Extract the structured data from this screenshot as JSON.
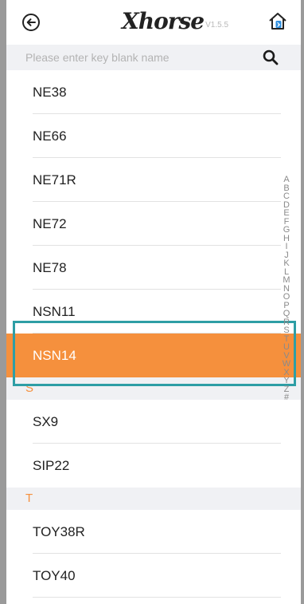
{
  "header": {
    "brand": "Xhorse",
    "version": "V1.5.5",
    "icons": {
      "back": "back-arrow-icon",
      "home": "home-bluetooth-icon"
    }
  },
  "search": {
    "placeholder": "Please enter key blank name",
    "value": "",
    "icon": "search-icon"
  },
  "list": {
    "items_top": [
      "NE38",
      "NE66",
      "NE71R",
      "NE72",
      "NE78",
      "NSN11"
    ],
    "selected": "NSN14",
    "section_s": "S",
    "items_s": [
      "SX9",
      "SIP22"
    ],
    "section_t": "T",
    "items_t": [
      "TOY38R",
      "TOY40"
    ]
  },
  "index": [
    "A",
    "B",
    "C",
    "D",
    "E",
    "F",
    "G",
    "H",
    "I",
    "J",
    "K",
    "L",
    "M",
    "N",
    "O",
    "P",
    "Q",
    "R",
    "S",
    "T",
    "U",
    "V",
    "W",
    "X",
    "Y",
    "Z",
    "#"
  ],
  "colors": {
    "accent": "#f5903d",
    "highlight": "#2e9ea5",
    "searchbar": "#f0f1f4"
  }
}
